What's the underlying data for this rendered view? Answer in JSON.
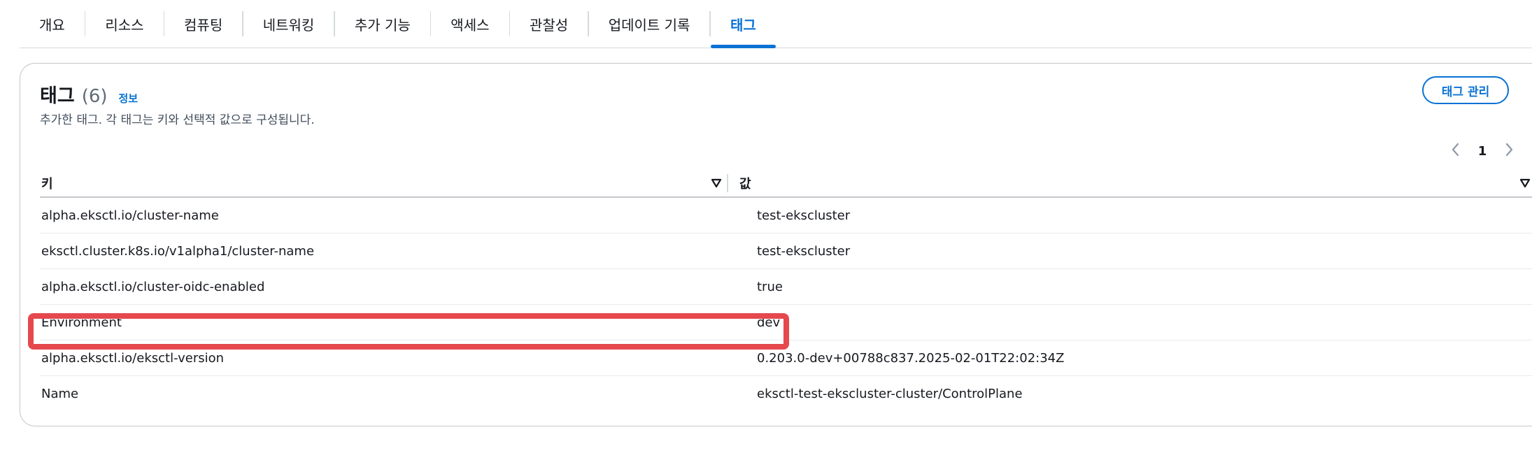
{
  "tabs": [
    {
      "label": "개요"
    },
    {
      "label": "리소스"
    },
    {
      "label": "컴퓨팅"
    },
    {
      "label": "네트워킹"
    },
    {
      "label": "추가 기능"
    },
    {
      "label": "액세스"
    },
    {
      "label": "관찰성"
    },
    {
      "label": "업데이트 기록"
    },
    {
      "label": "태그",
      "active": true
    }
  ],
  "card": {
    "title": "태그",
    "count": "(6)",
    "info": "정보",
    "description": "추가한 태그. 각 태그는 키와 선택적 값으로 구성됩니다.",
    "manage_button": "태그 관리"
  },
  "pagination": {
    "page": "1"
  },
  "table": {
    "headers": {
      "key": "키",
      "value": "값"
    },
    "rows": [
      {
        "key": "alpha.eksctl.io/cluster-name",
        "value": "test-ekscluster"
      },
      {
        "key": "eksctl.cluster.k8s.io/v1alpha1/cluster-name",
        "value": "test-ekscluster"
      },
      {
        "key": "alpha.eksctl.io/cluster-oidc-enabled",
        "value": "true"
      },
      {
        "key": "Environment",
        "value": "dev"
      },
      {
        "key": "alpha.eksctl.io/eksctl-version",
        "value": "0.203.0-dev+00788c837.2025-02-01T22:02:34Z"
      },
      {
        "key": "Name",
        "value": "eksctl-test-ekscluster-cluster/ControlPlane"
      }
    ]
  },
  "colors": {
    "accent": "#0972d3",
    "highlight": "#e5484d"
  },
  "icons": {
    "sort": "sort-triangle-icon",
    "prev": "chevron-left-icon",
    "next": "chevron-right-icon"
  }
}
